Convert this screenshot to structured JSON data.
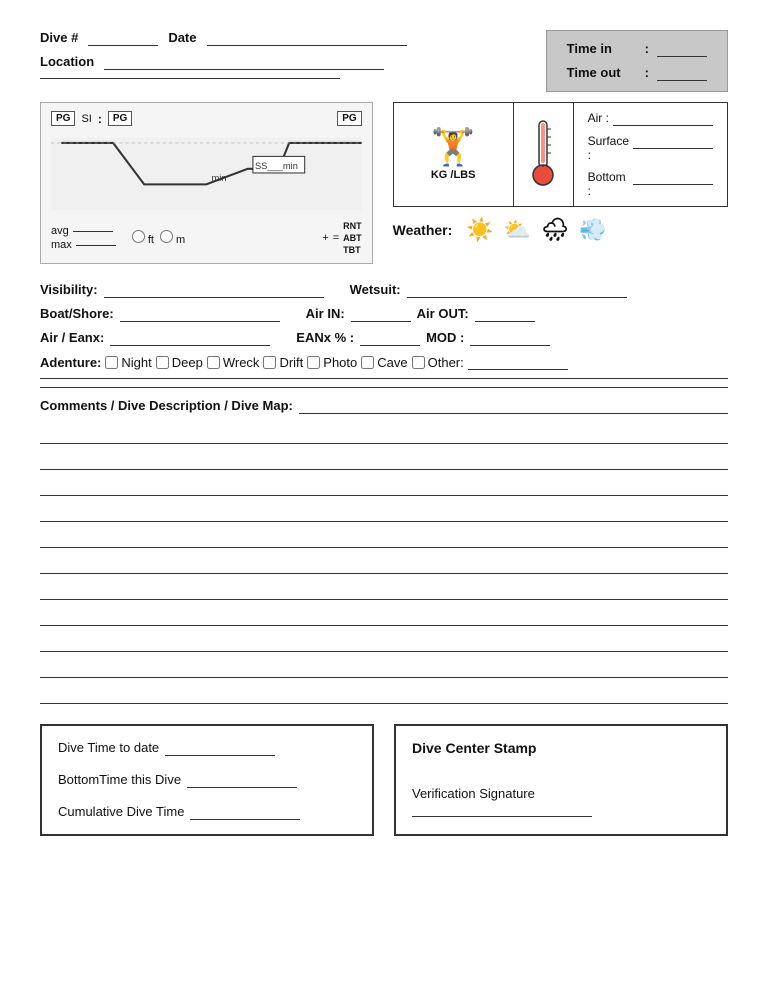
{
  "header": {
    "dive_label": "Dive #",
    "date_label": "Date",
    "location_label": "Location",
    "time_in_label": "Time in",
    "time_out_label": "Time out"
  },
  "dive_profile": {
    "pg_label": "PG",
    "si_label": "SI",
    "avg_label": "avg",
    "max_label": "max",
    "ft_label": "ft",
    "m_label": "m",
    "min_label": "min",
    "ss_label": "SS",
    "rnt_label": "RNT",
    "abt_label": "ABT",
    "tbt_label": "TBT",
    "plus_label": "+",
    "equals_label": "="
  },
  "weight": {
    "icon": "⚖",
    "label": "KG /LBS"
  },
  "temperature": {
    "air_label": "Air :",
    "surface_label": "Surface :",
    "bottom_label": "Bottom :"
  },
  "weather": {
    "label": "Weather:",
    "icons": [
      "☀",
      "⛅",
      "🌧",
      "💨"
    ]
  },
  "form": {
    "visibility_label": "Visibility:",
    "boat_shore_label": "Boat/Shore:",
    "air_eanx_label": "Air / Eanx:",
    "wetsuit_label": "Wetsuit:",
    "air_in_label": "Air IN:",
    "air_out_label": "Air OUT:",
    "eanx_label": "EANx % :",
    "mod_label": "MOD :",
    "adventure_label": "Adenture:",
    "checkboxes": [
      {
        "id": "night",
        "label": "Night"
      },
      {
        "id": "deep",
        "label": "Deep"
      },
      {
        "id": "wreck",
        "label": "Wreck"
      },
      {
        "id": "drift",
        "label": "Drift"
      },
      {
        "id": "photo",
        "label": "Photo"
      },
      {
        "id": "cave",
        "label": "Cave"
      },
      {
        "id": "other",
        "label": "Other:"
      }
    ]
  },
  "comments": {
    "label": "Comments / Dive Description / Dive Map:"
  },
  "bottom_section": {
    "dive_time_label": "Dive Time to date",
    "bottom_time_label": "BottomTime this Dive",
    "cumulative_label": "Cumulative Dive Time",
    "stamp_label": "Dive Center Stamp",
    "verification_label": "Verification Signature"
  }
}
